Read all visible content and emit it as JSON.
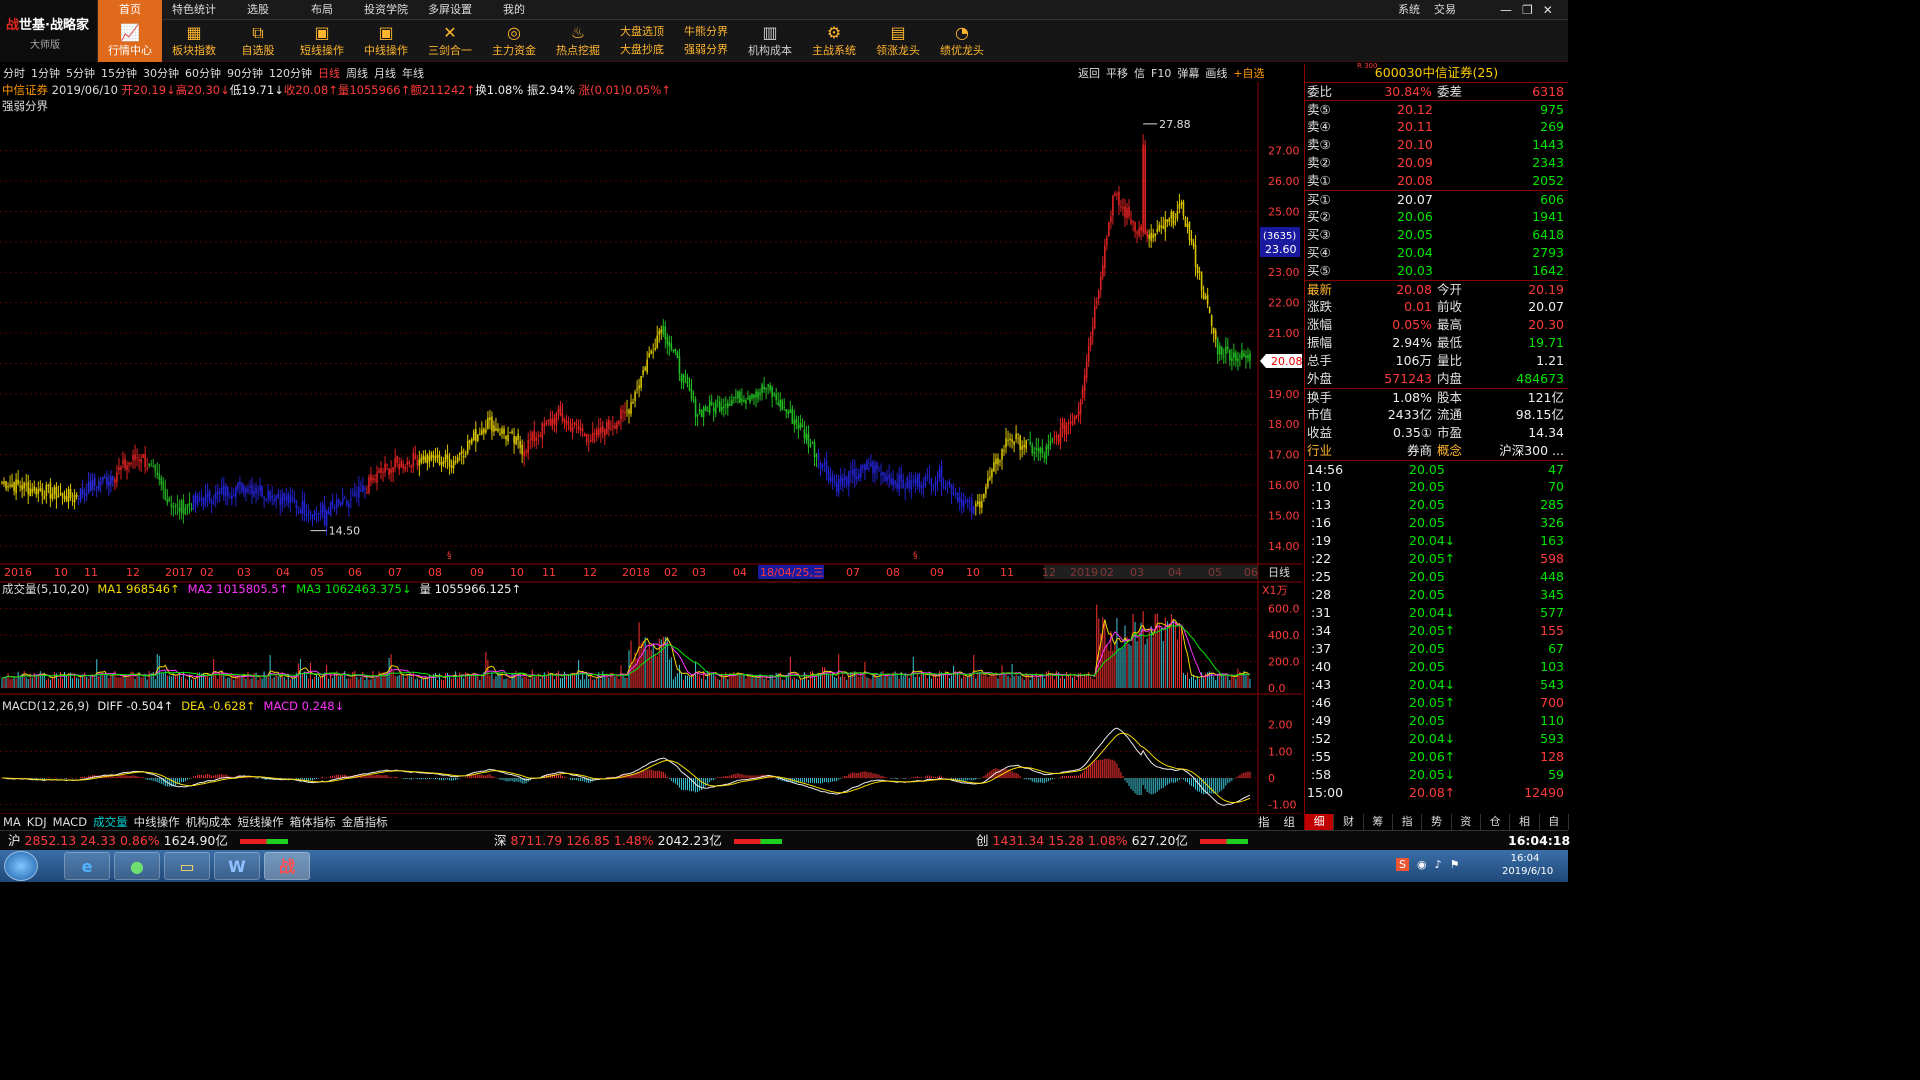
{
  "app": {
    "brand": "世基·战略家",
    "edition": "大师版",
    "brand_mark": "战"
  },
  "menus": [
    "首页",
    "特色统计",
    "选股",
    "布局",
    "投资学院",
    "多屏设置",
    "我的"
  ],
  "system_menu": [
    "系统",
    "交易"
  ],
  "window_buttons": [
    "—",
    "❐",
    "✕"
  ],
  "toolbar": [
    {
      "label": "行情中心",
      "icon": "chart-icon",
      "active": true
    },
    {
      "label": "板块指数",
      "icon": "grid-icon"
    },
    {
      "label": "自选股",
      "icon": "selfpick-icon"
    },
    {
      "label": "短线操作",
      "icon": "monitor-icon"
    },
    {
      "label": "中线操作",
      "icon": "monitor-icon"
    },
    {
      "label": "三剑合一",
      "icon": "swords-icon"
    },
    {
      "label": "主力资金",
      "icon": "coins-icon"
    },
    {
      "label": "热点挖掘",
      "icon": "fire-icon"
    },
    {
      "label": "大盘选顶",
      "label2": "大盘抄底",
      "two": true
    },
    {
      "label": "牛熊分界",
      "label2": "强弱分界",
      "two": true
    },
    {
      "label": "机构成本",
      "icon": "building-icon",
      "gray": true
    },
    {
      "label": "主战系统",
      "icon": "gear-icon"
    },
    {
      "label": "领涨龙头",
      "icon": "bars-icon"
    },
    {
      "label": "绩优龙头",
      "icon": "pie-icon"
    }
  ],
  "periods": [
    "分时",
    "1分钟",
    "5分钟",
    "15分钟",
    "30分钟",
    "60分钟",
    "90分钟",
    "120分钟",
    "日线",
    "周线",
    "月线",
    "年线"
  ],
  "active_period": "日线",
  "kline_tools": [
    "返回",
    "平移",
    "信",
    "F10",
    "弹幕",
    "画线",
    "+自选"
  ],
  "info": {
    "name": "中信证券",
    "date": "2019/06/10",
    "open": "开20.19↓",
    "high": "高20.30↓",
    "low": "低19.71↓",
    "close": "收20.08↑",
    "vol": "量1055966↑",
    "amt": "额211242↑",
    "turn": "换1.08%",
    "amp": "振2.94%",
    "chg": "涨(0.01)0.05%↑"
  },
  "indicator_name": "强弱分界",
  "price_axis": [
    "27.00",
    "26.00",
    "25.00",
    "24.00",
    "23.00",
    "22.00",
    "21.00",
    "20.00",
    "19.00",
    "18.00",
    "17.00",
    "16.00",
    "15.00",
    "14.00"
  ],
  "price_labels": {
    "high": "27.88",
    "low": "14.50",
    "cross_count": "(3635)",
    "cross_price": "23.60",
    "current": "20.08"
  },
  "x_labels": [
    "2016",
    "10",
    "11",
    "12",
    "2017",
    "02",
    "03",
    "04",
    "05",
    "06",
    "07",
    "08",
    "09",
    "10",
    "11",
    "12",
    "2018",
    "02",
    "03",
    "04",
    "18/04/25,三",
    "07",
    "08",
    "09",
    "10",
    "11",
    "12",
    "2019",
    "02",
    "03",
    "04",
    "05",
    "06"
  ],
  "x_axis_mode": "日线",
  "volume": {
    "title": "成交量(5,10,20)",
    "ma1": "MA1 968546↑",
    "ma2": "MA2 1015805.5↑",
    "ma3": "MA3 1062463.375↓",
    "vol": "量 1055966.125↑",
    "unit": "X1万",
    "axis": [
      "600.0",
      "400.0",
      "200.0",
      "0.0"
    ]
  },
  "macd": {
    "title": "MACD(12,26,9)",
    "diff": "DIFF -0.504↑",
    "dea": "DEA -0.628↑",
    "macd": "MACD 0.248↓",
    "axis": [
      "2.00",
      "1.00",
      "0",
      "-1.00"
    ]
  },
  "bottom_tabs": [
    "MA",
    "KDJ",
    "MACD",
    "成交量",
    "中线操作",
    "机构成本",
    "短线操作",
    "箱体指标",
    "金盾指标"
  ],
  "bottom_right_tabs": [
    "指",
    "组"
  ],
  "status": {
    "sh": {
      "name": "沪",
      "value": "2852.13",
      "chg": "24.33",
      "pct": "0.86%",
      "amt": "1624.90亿"
    },
    "sz": {
      "name": "深",
      "value": "8711.79",
      "chg": "126.85",
      "pct": "1.48%",
      "amt": "2042.23亿"
    },
    "cy": {
      "name": "创",
      "value": "1431.34",
      "chg": "15.28",
      "pct": "1.08%",
      "amt": "627.20亿"
    },
    "time": "16:04:18"
  },
  "stock": {
    "code": "600030",
    "name": "中信证券(25)",
    "tag": "R 300"
  },
  "order_book": {
    "weibi_label": "委比",
    "weibi": "30.84%",
    "weicha_label": "委差",
    "weicha": "6318",
    "sell": [
      {
        "l": "卖⑤",
        "p": "20.12",
        "v": "975"
      },
      {
        "l": "卖④",
        "p": "20.11",
        "v": "269"
      },
      {
        "l": "卖③",
        "p": "20.10",
        "v": "1443"
      },
      {
        "l": "卖②",
        "p": "20.09",
        "v": "2343"
      },
      {
        "l": "卖①",
        "p": "20.08",
        "v": "2052"
      }
    ],
    "buy": [
      {
        "l": "买①",
        "p": "20.07",
        "v": "606"
      },
      {
        "l": "买②",
        "p": "20.06",
        "v": "1941"
      },
      {
        "l": "买③",
        "p": "20.05",
        "v": "6418"
      },
      {
        "l": "买④",
        "p": "20.04",
        "v": "2793"
      },
      {
        "l": "买⑤",
        "p": "20.03",
        "v": "1642"
      }
    ]
  },
  "quote": [
    {
      "l1": "最新",
      "v1": "20.08",
      "l2": "今开",
      "v2": "20.19"
    },
    {
      "l1": "涨跌",
      "v1": "0.01",
      "l2": "前收",
      "v2": "20.07"
    },
    {
      "l1": "涨幅",
      "v1": "0.05%",
      "l2": "最高",
      "v2": "20.30"
    },
    {
      "l1": "振幅",
      "v1": "2.94%",
      "l2": "最低",
      "v2": "19.71"
    },
    {
      "l1": "总手",
      "v1": "106万",
      "l2": "量比",
      "v2": "1.21"
    },
    {
      "l1": "外盘",
      "v1": "571243",
      "l2": "内盘",
      "v2": "484673"
    }
  ],
  "fundamentals": [
    {
      "l1": "换手",
      "v1": "1.08%",
      "l2": "股本",
      "v2": "121亿"
    },
    {
      "l1": "市值",
      "v1": "2433亿",
      "l2": "流通",
      "v2": "98.15亿"
    },
    {
      "l1": "收益",
      "v1": "0.35①",
      "l2": "市盈",
      "v2": "14.34"
    },
    {
      "l1": "行业",
      "v1": "券商",
      "l2": "概念",
      "v2": "沪深300 ..."
    }
  ],
  "ticks": [
    {
      "t": "14:56",
      "p": "20.05",
      "v": "47"
    },
    {
      "t": ":10",
      "p": "20.05",
      "v": "70"
    },
    {
      "t": ":13",
      "p": "20.05",
      "v": "285"
    },
    {
      "t": ":16",
      "p": "20.05",
      "v": "326"
    },
    {
      "t": ":19",
      "p": "20.04↓",
      "v": "163"
    },
    {
      "t": ":22",
      "p": "20.05↑",
      "v": "598"
    },
    {
      "t": ":25",
      "p": "20.05",
      "v": "448"
    },
    {
      "t": ":28",
      "p": "20.05",
      "v": "345"
    },
    {
      "t": ":31",
      "p": "20.04↓",
      "v": "577"
    },
    {
      "t": ":34",
      "p": "20.05↑",
      "v": "155"
    },
    {
      "t": ":37",
      "p": "20.05",
      "v": "67"
    },
    {
      "t": ":40",
      "p": "20.05",
      "v": "103"
    },
    {
      "t": ":43",
      "p": "20.04↓",
      "v": "543"
    },
    {
      "t": ":46",
      "p": "20.05↑",
      "v": "700"
    },
    {
      "t": ":49",
      "p": "20.05",
      "v": "110"
    },
    {
      "t": ":52",
      "p": "20.04↓",
      "v": "593"
    },
    {
      "t": ":55",
      "p": "20.06↑",
      "v": "128"
    },
    {
      "t": ":58",
      "p": "20.05↓",
      "v": "59"
    },
    {
      "t": "15:00",
      "p": "20.08↑",
      "v": "12490"
    }
  ],
  "right_tabs": [
    "细",
    "财",
    "筹",
    "指",
    "势",
    "资",
    "仓",
    "相",
    "自"
  ],
  "taskbar": {
    "time": "16:04",
    "date": "2019/6/10"
  },
  "chart_data": {
    "type": "candlestick",
    "title": "",
    "ylim": [
      13.6,
      28.6
    ],
    "y_ticks": [
      14,
      15,
      16,
      17,
      18,
      19,
      20,
      21,
      22,
      23,
      24,
      25,
      26,
      27
    ],
    "x_months": [
      "2016-09",
      "2016-10",
      "2016-11",
      "2016-12",
      "2017-01",
      "2017-02",
      "2017-03",
      "2017-04",
      "2017-05",
      "2017-06",
      "2017-07",
      "2017-08",
      "2017-09",
      "2017-10",
      "2017-11",
      "2017-12",
      "2018-01",
      "2018-02",
      "2018-03",
      "2018-04",
      "2018-05",
      "2018-06",
      "2018-07",
      "2018-08",
      "2018-09",
      "2018-10",
      "2018-11",
      "2018-12",
      "2019-01",
      "2019-02",
      "2019-03",
      "2019-04",
      "2019-05",
      "2019-06"
    ],
    "close_path": [
      [
        0,
        16.1
      ],
      [
        2,
        15.6
      ],
      [
        3,
        16.2
      ],
      [
        4,
        17.0
      ],
      [
        5,
        15.2
      ],
      [
        6,
        15.6
      ],
      [
        7,
        16.0
      ],
      [
        8,
        15.6
      ],
      [
        9,
        15.1
      ],
      [
        10,
        15.4
      ],
      [
        11,
        16.5
      ],
      [
        12,
        16.9
      ],
      [
        13,
        16.8
      ],
      [
        14,
        18.1
      ],
      [
        15,
        17.2
      ],
      [
        16,
        18.3
      ],
      [
        17,
        17.5
      ],
      [
        18,
        18.4
      ],
      [
        19,
        21.3
      ],
      [
        20,
        18.4
      ],
      [
        21,
        18.8
      ],
      [
        22,
        19.2
      ],
      [
        23,
        17.9
      ],
      [
        24,
        16.0
      ],
      [
        25,
        16.6
      ],
      [
        26,
        16.0
      ],
      [
        27,
        16.3
      ],
      [
        28,
        15.1
      ],
      [
        29,
        17.6
      ],
      [
        30,
        17.0
      ],
      [
        31,
        18.5
      ],
      [
        32,
        25.5
      ],
      [
        33,
        24.0
      ],
      [
        34,
        25.1
      ],
      [
        35,
        20.5
      ],
      [
        36,
        20.1
      ]
    ],
    "markers": {
      "high": 27.88,
      "low": 14.5,
      "current": 20.08
    },
    "volume_max": 650,
    "macd_ylim": [
      -1.2,
      2.4
    ]
  }
}
